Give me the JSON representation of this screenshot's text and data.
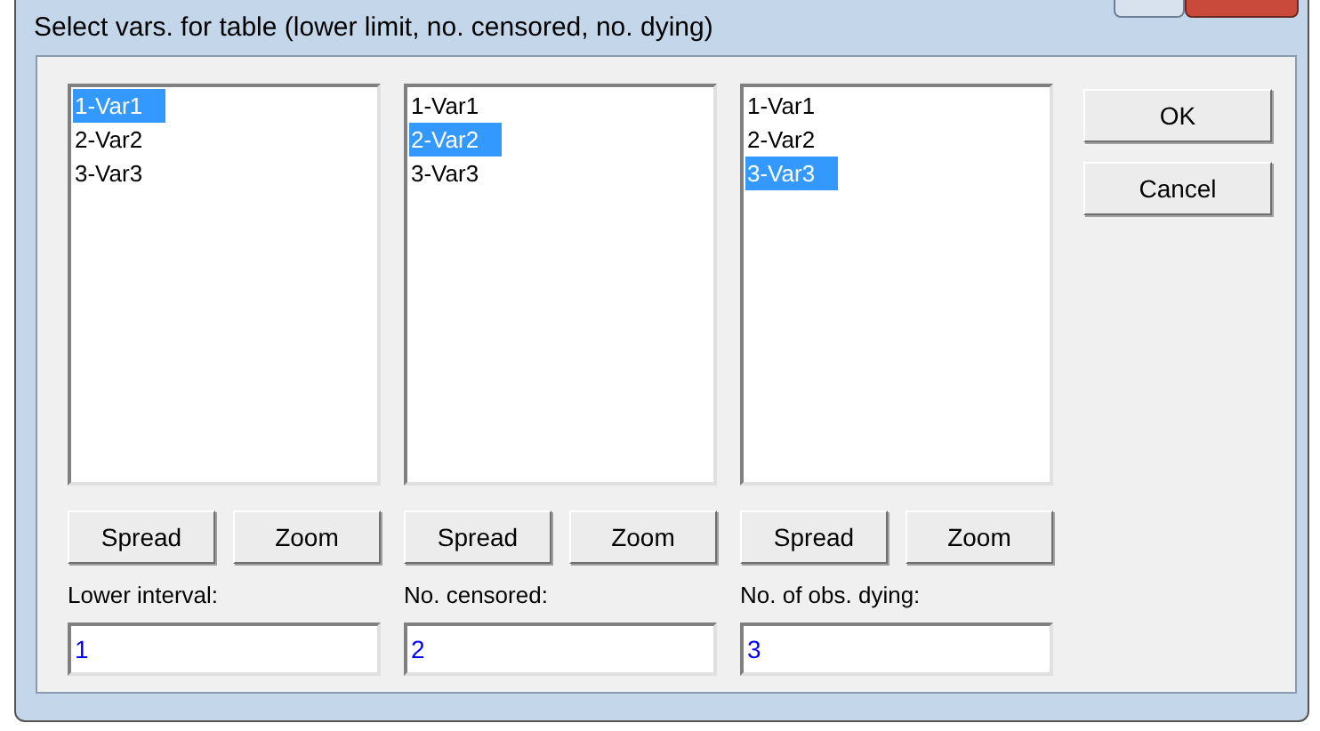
{
  "window": {
    "title": "Select vars. for table (lower limit, no. censored, no. dying)"
  },
  "columns": [
    {
      "items": [
        {
          "label": "1-Var1",
          "selected": true
        },
        {
          "label": "2-Var2",
          "selected": false
        },
        {
          "label": "3-Var3",
          "selected": false
        }
      ],
      "buttons": [
        "Spread",
        "Zoom"
      ],
      "field_label": "Lower interval:",
      "field_value": "1"
    },
    {
      "items": [
        {
          "label": "1-Var1",
          "selected": false
        },
        {
          "label": "2-Var2",
          "selected": true
        },
        {
          "label": "3-Var3",
          "selected": false
        }
      ],
      "buttons": [
        "Spread",
        "Zoom"
      ],
      "field_label": "No. censored:",
      "field_value": "2"
    },
    {
      "items": [
        {
          "label": "1-Var1",
          "selected": false
        },
        {
          "label": "2-Var2",
          "selected": false
        },
        {
          "label": "3-Var3",
          "selected": true
        }
      ],
      "buttons": [
        "Spread",
        "Zoom"
      ],
      "field_label": "No. of obs. dying:",
      "field_value": "3"
    }
  ],
  "buttons": [
    "OK",
    "Cancel"
  ]
}
